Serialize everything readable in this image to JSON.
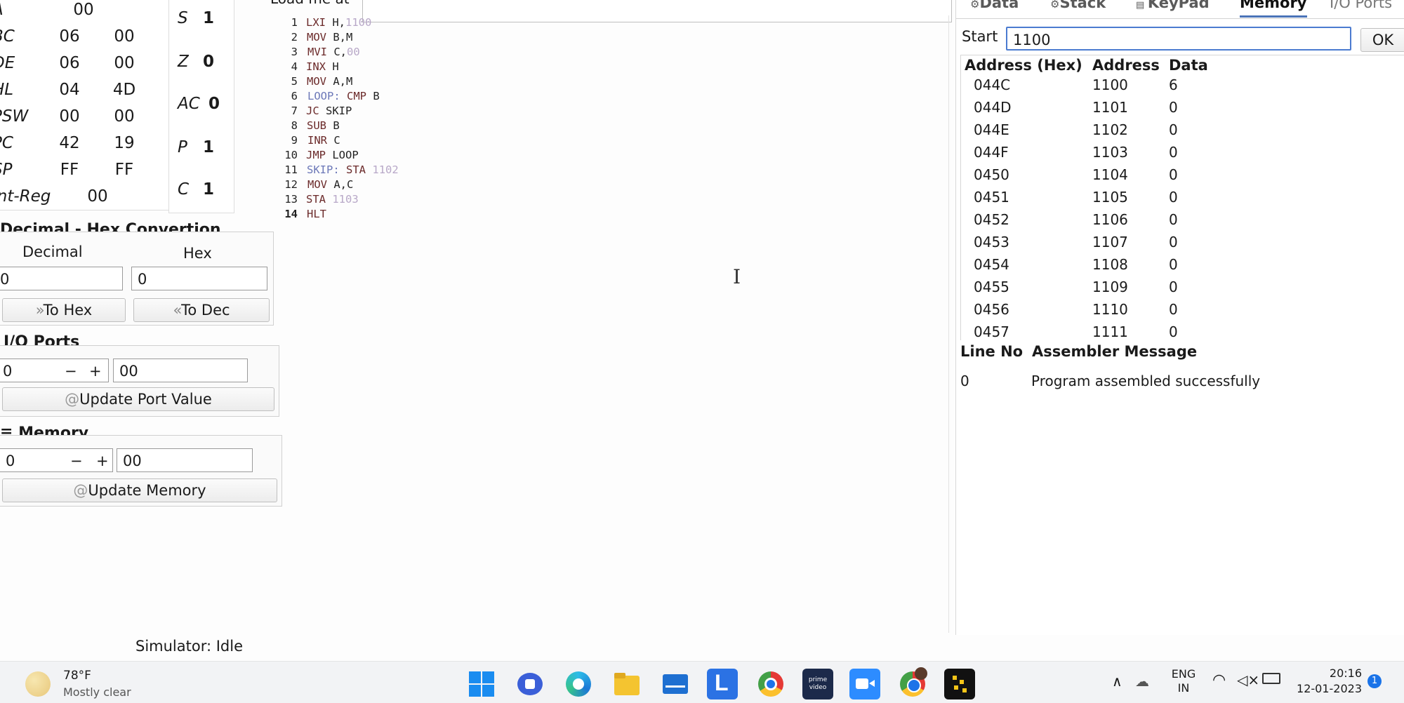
{
  "registers": [
    {
      "name": "A",
      "hi": "",
      "lo": "00",
      "single": true
    },
    {
      "name": "BC",
      "hi": "06",
      "lo": "00"
    },
    {
      "name": "DE",
      "hi": "06",
      "lo": "00"
    },
    {
      "name": "HL",
      "hi": "04",
      "lo": "4D"
    },
    {
      "name": "PSW",
      "hi": "00",
      "lo": "00"
    },
    {
      "name": "PC",
      "hi": "42",
      "lo": "19"
    },
    {
      "name": "SP",
      "hi": "FF",
      "lo": "FF"
    },
    {
      "name": "Int-Reg",
      "hi": "",
      "lo": "00",
      "single": true
    }
  ],
  "flags": [
    {
      "name": "S",
      "value": "1"
    },
    {
      "name": "Z",
      "value": "0"
    },
    {
      "name": "AC",
      "value": "0"
    },
    {
      "name": "P",
      "value": "1"
    },
    {
      "name": "C",
      "value": "1"
    }
  ],
  "editor": {
    "load_label": "Load me at",
    "lines": [
      {
        "n": "1",
        "label": "",
        "op": "LXI",
        "arg": "H,",
        "num": "1100"
      },
      {
        "n": "2",
        "label": "",
        "op": "MOV",
        "arg": "B,M",
        "num": ""
      },
      {
        "n": "3",
        "label": "",
        "op": "MVI",
        "arg": "C,",
        "num": "00"
      },
      {
        "n": "4",
        "label": "",
        "op": "INX",
        "arg": "H",
        "num": ""
      },
      {
        "n": "5",
        "label": "",
        "op": "MOV",
        "arg": "A,M",
        "num": ""
      },
      {
        "n": "6",
        "label": "LOOP:",
        "op": "CMP",
        "arg": "B",
        "num": ""
      },
      {
        "n": "7",
        "label": "",
        "op": "JC",
        "arg": "SKIP",
        "num": ""
      },
      {
        "n": "8",
        "label": "",
        "op": "SUB",
        "arg": "B",
        "num": ""
      },
      {
        "n": "9",
        "label": "",
        "op": "INR",
        "arg": "C",
        "num": ""
      },
      {
        "n": "10",
        "label": "",
        "op": "JMP",
        "arg": "LOOP",
        "num": ""
      },
      {
        "n": "11",
        "label": "SKIP:",
        "op": "STA",
        "arg": "",
        "num": "1102"
      },
      {
        "n": "12",
        "label": "",
        "op": "MOV",
        "arg": "A,C",
        "num": ""
      },
      {
        "n": "13",
        "label": "",
        "op": "STA",
        "arg": "",
        "num": "1103"
      },
      {
        "n": "14",
        "label": "",
        "op": "HLT",
        "arg": "",
        "num": ""
      }
    ]
  },
  "conversion": {
    "title": "Decimal - Hex Convertion",
    "decimal_label": "Decimal",
    "hex_label": "Hex",
    "decimal_value": "0",
    "hex_value": "0",
    "to_hex": "To Hex",
    "to_dec": "To Dec"
  },
  "io_ports": {
    "title": "I/O Ports",
    "port": "0",
    "minus": "−",
    "plus": "+",
    "value": "00",
    "update": "Update Port Value"
  },
  "memory_edit": {
    "title": "Memory",
    "address": "0",
    "minus": "−",
    "plus": "+",
    "value": "00",
    "update": "Update Memory"
  },
  "status": "Simulator: Idle",
  "tabs": [
    "Data",
    "Stack",
    "KeyPad",
    "Memory",
    "I/O Ports"
  ],
  "active_tab": "Memory",
  "memory_view": {
    "start_label": "Start",
    "start_value": "1100",
    "ok": "OK",
    "headers": [
      "Address (Hex)",
      "Address",
      "Data"
    ],
    "rows": [
      {
        "hex": "044C",
        "addr": "1100",
        "data": "6"
      },
      {
        "hex": "044D",
        "addr": "1101",
        "data": "0"
      },
      {
        "hex": "044E",
        "addr": "1102",
        "data": "0"
      },
      {
        "hex": "044F",
        "addr": "1103",
        "data": "0"
      },
      {
        "hex": "0450",
        "addr": "1104",
        "data": "0"
      },
      {
        "hex": "0451",
        "addr": "1105",
        "data": "0"
      },
      {
        "hex": "0452",
        "addr": "1106",
        "data": "0"
      },
      {
        "hex": "0453",
        "addr": "1107",
        "data": "0"
      },
      {
        "hex": "0454",
        "addr": "1108",
        "data": "0"
      },
      {
        "hex": "0455",
        "addr": "1109",
        "data": "0"
      },
      {
        "hex": "0456",
        "addr": "1110",
        "data": "0"
      },
      {
        "hex": "0457",
        "addr": "1111",
        "data": "0"
      }
    ]
  },
  "assembler": {
    "headers": [
      "Line No",
      "Assembler Message"
    ],
    "line": "0",
    "message": "Program assembled successfully"
  },
  "taskbar": {
    "weather_temp": "78°F",
    "weather_desc": "Mostly clear",
    "lang_top": "ENG",
    "lang_bottom": "IN",
    "time": "20:16",
    "date": "12-01-2023",
    "apps": [
      "start-icon",
      "chat-icon",
      "edge-icon",
      "explorer-icon",
      "mail-icon",
      "l-app-icon",
      "chrome-icon",
      "prime-video-icon",
      "zoom-icon",
      "chrome-profile-icon",
      "simulator-icon"
    ],
    "prime_text": "prime video",
    "l_text": "L"
  }
}
